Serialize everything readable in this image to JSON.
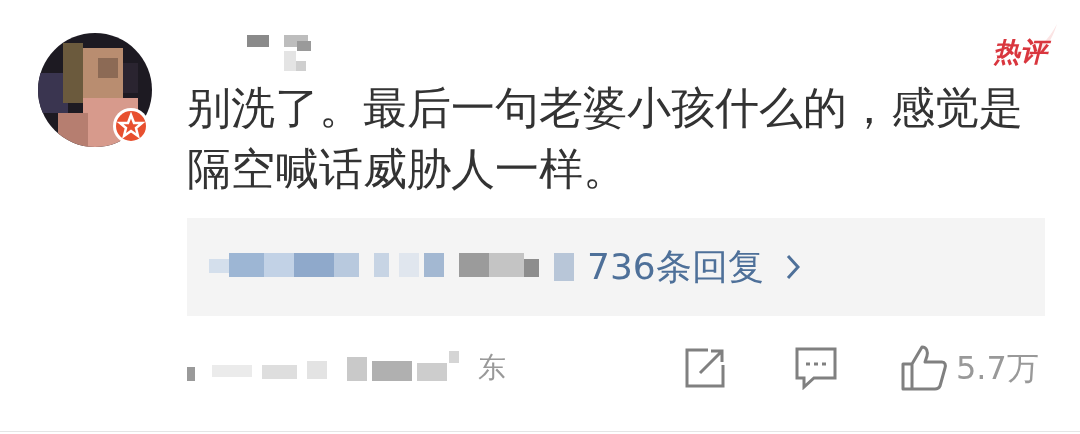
{
  "comment": {
    "badge": "热评",
    "text": "别洗了。最后一句老婆小孩什么的，感觉是隔空喊话威胁人一样。",
    "replies": {
      "label": "736条回复"
    },
    "footer": {
      "location_fragment": "东",
      "like_count": "5.7万"
    }
  }
}
